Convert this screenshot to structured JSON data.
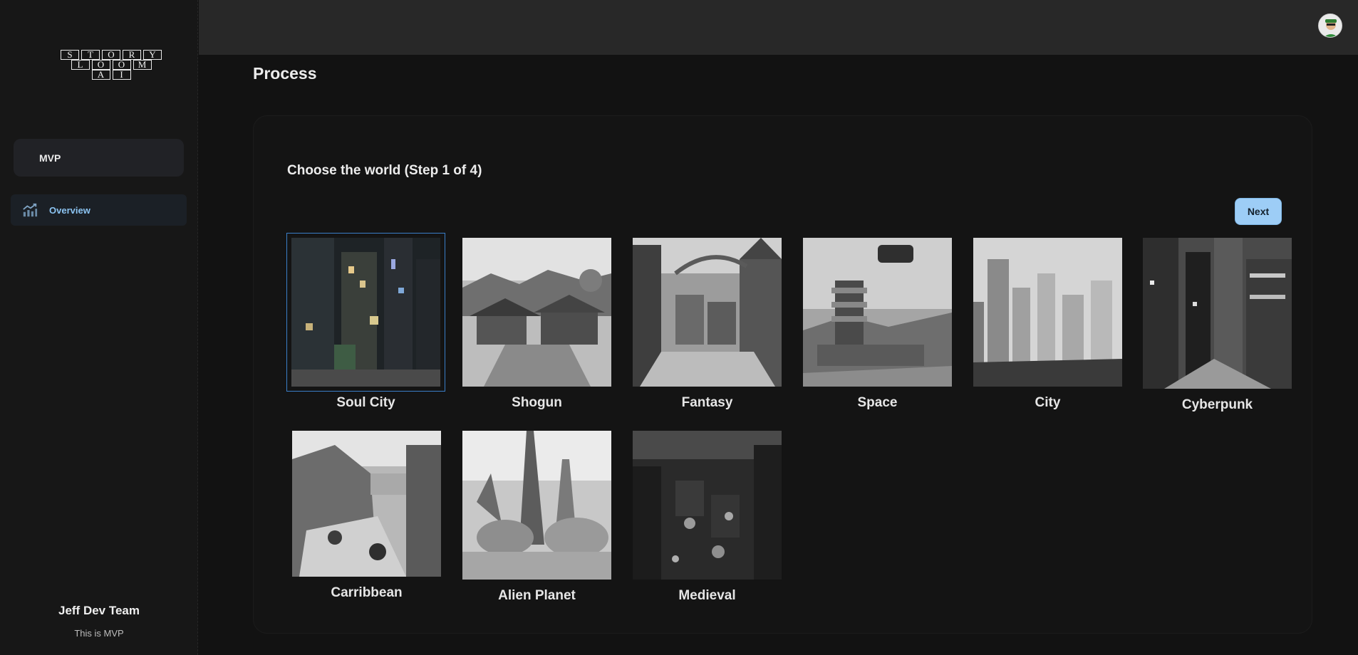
{
  "logo": {
    "row1": [
      "S",
      "T",
      "O",
      "R",
      "Y"
    ],
    "row2": [
      "L",
      "O",
      "O",
      "M"
    ],
    "row3": [
      "A",
      "I"
    ]
  },
  "sidebar": {
    "project": "MVP",
    "nav": [
      {
        "label": "Overview",
        "icon": "chart-trend-icon"
      }
    ],
    "team_name": "Jeff Dev Team",
    "team_subtitle": "This is MVP"
  },
  "header": {
    "avatar_icon": "user-avatar"
  },
  "main": {
    "title": "Process",
    "step_title": "Choose the world (Step 1 of 4)",
    "next_label": "Next",
    "selected": "Soul City",
    "worlds": [
      {
        "label": "Soul City"
      },
      {
        "label": "Shogun"
      },
      {
        "label": "Fantasy"
      },
      {
        "label": "Space"
      },
      {
        "label": "City"
      },
      {
        "label": "Cyberpunk"
      },
      {
        "label": "Carribbean"
      },
      {
        "label": "Alien Planet"
      },
      {
        "label": "Medieval"
      }
    ]
  },
  "colors": {
    "accent": "#9dcdf6",
    "nav_active_text": "#8cc4f2",
    "selection_border": "#3a7ec8",
    "background": "#121212"
  }
}
